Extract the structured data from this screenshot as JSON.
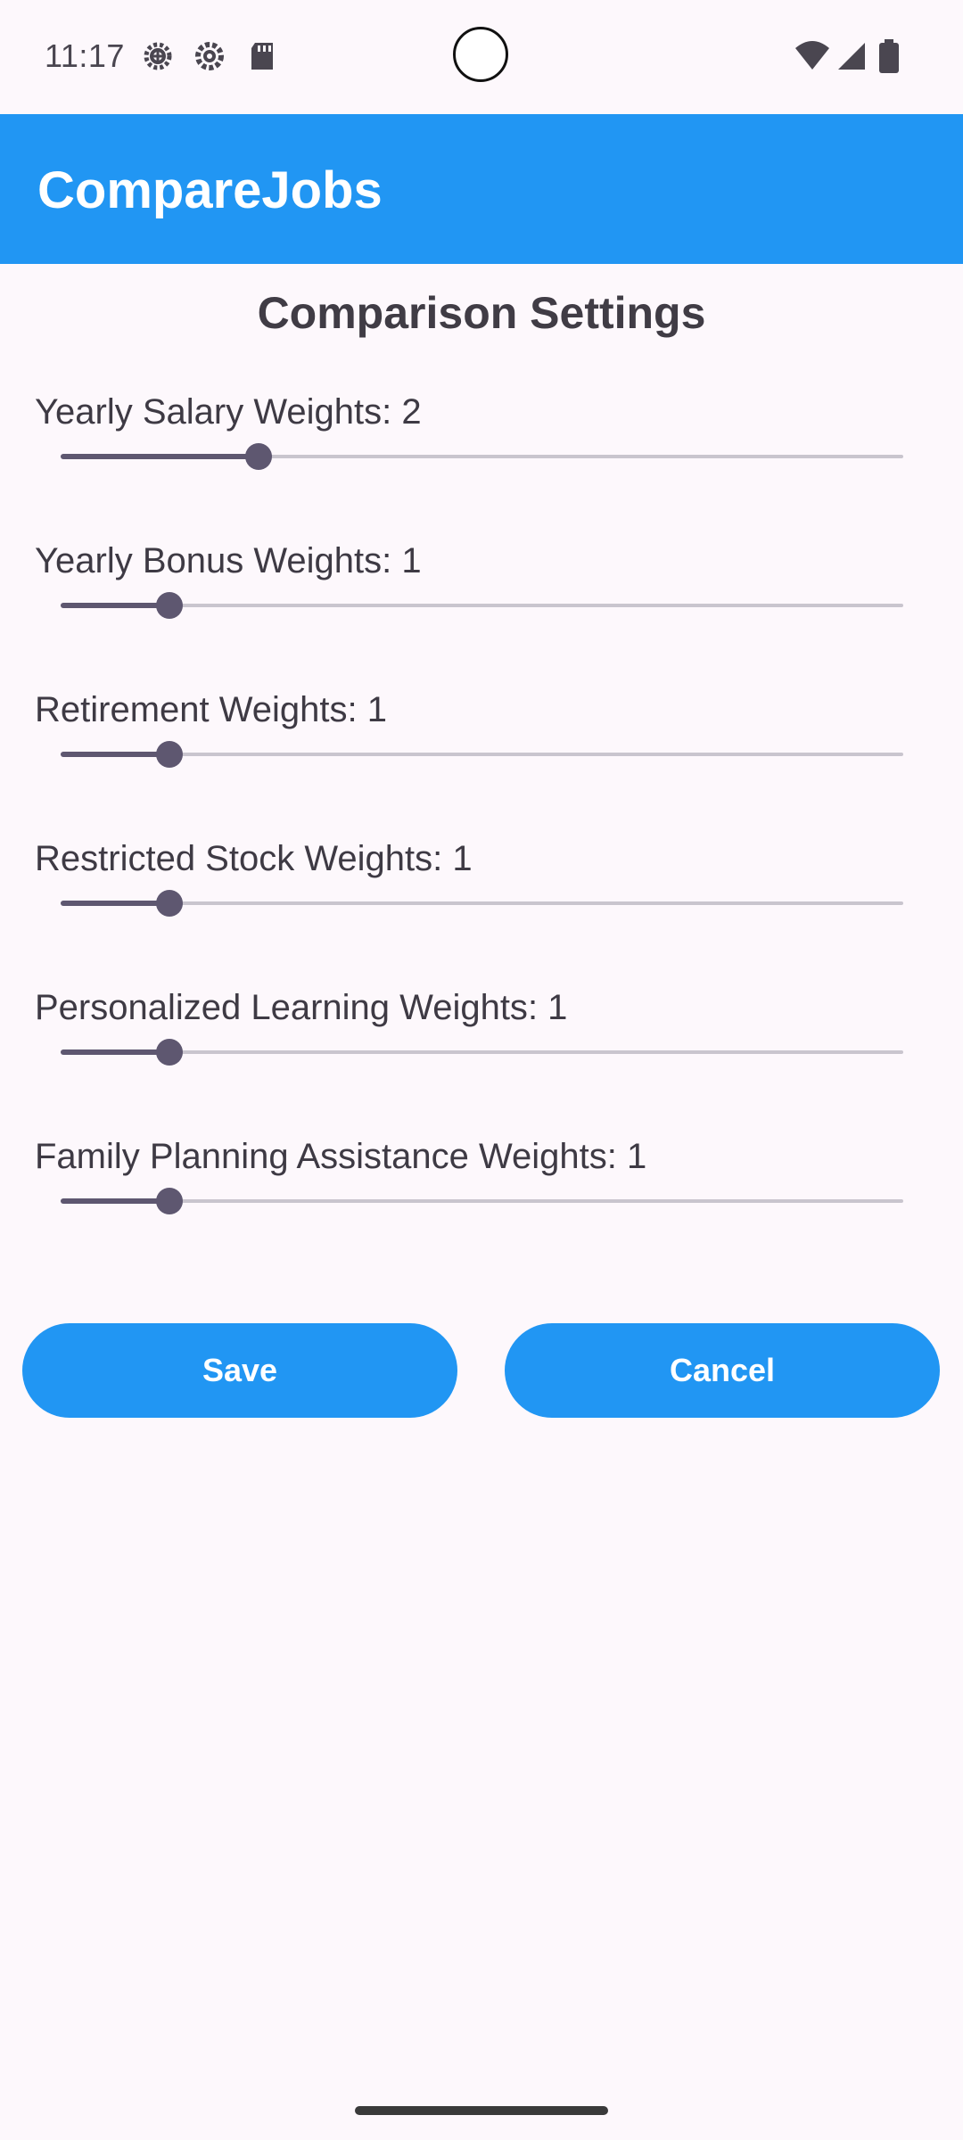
{
  "status_bar": {
    "time": "11:17",
    "left_icons": [
      "gear-badge-icon",
      "settings-gear-icon",
      "sd-card-icon"
    ],
    "right_icons": [
      "wifi-icon",
      "cellular-signal-icon",
      "battery-icon"
    ]
  },
  "app_bar": {
    "title": "CompareJobs"
  },
  "page": {
    "title": "Comparison Settings"
  },
  "weights": [
    {
      "label": "Yearly Salary Weights",
      "value": "2",
      "slider_value": 2,
      "slider_max": 9
    },
    {
      "label": "Yearly Bonus Weights",
      "value": "1",
      "slider_value": 1,
      "slider_max": 9
    },
    {
      "label": "Retirement Weights",
      "value": "1",
      "slider_value": 1,
      "slider_max": 9
    },
    {
      "label": "Restricted Stock Weights",
      "value": "1",
      "slider_value": 1,
      "slider_max": 9
    },
    {
      "label": "Personalized Learning Weights",
      "value": "1",
      "slider_value": 1,
      "slider_max": 9
    },
    {
      "label": "Family Planning Assistance Weights",
      "value": "1",
      "slider_value": 1,
      "slider_max": 9
    }
  ],
  "buttons": {
    "save_label": "Save",
    "cancel_label": "Cancel"
  },
  "colors": {
    "primary": "#2196F3",
    "slider_active": "#5E5770",
    "slider_inactive": "#C9C5CE",
    "background": "#FDF8FC"
  }
}
